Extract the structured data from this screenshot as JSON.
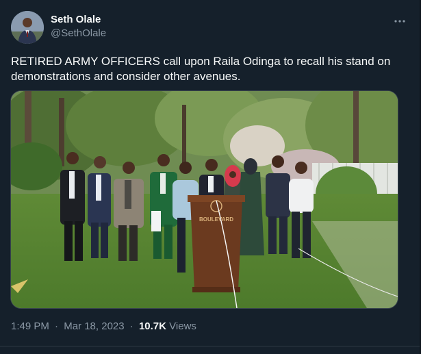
{
  "tweet": {
    "display_name": "Seth Olale",
    "handle": "@SethOlale",
    "text": "RETIRED ARMY OFFICERS call upon Raila Odinga to recall his stand on demonstrations and consider other avenues.",
    "time": "1:49 PM",
    "date": "Mar 18, 2023",
    "separator": "·",
    "views_count": "10.7K",
    "views_label": "Views"
  },
  "media": {
    "podium_text": "BOULEVARD"
  },
  "icons": {
    "more": "more-dots-icon",
    "avatar": "profile-avatar"
  },
  "colors": {
    "background": "#15202b",
    "primary_text": "#f7f9f9",
    "secondary_text": "#8b98a5",
    "border": "#38444d"
  }
}
